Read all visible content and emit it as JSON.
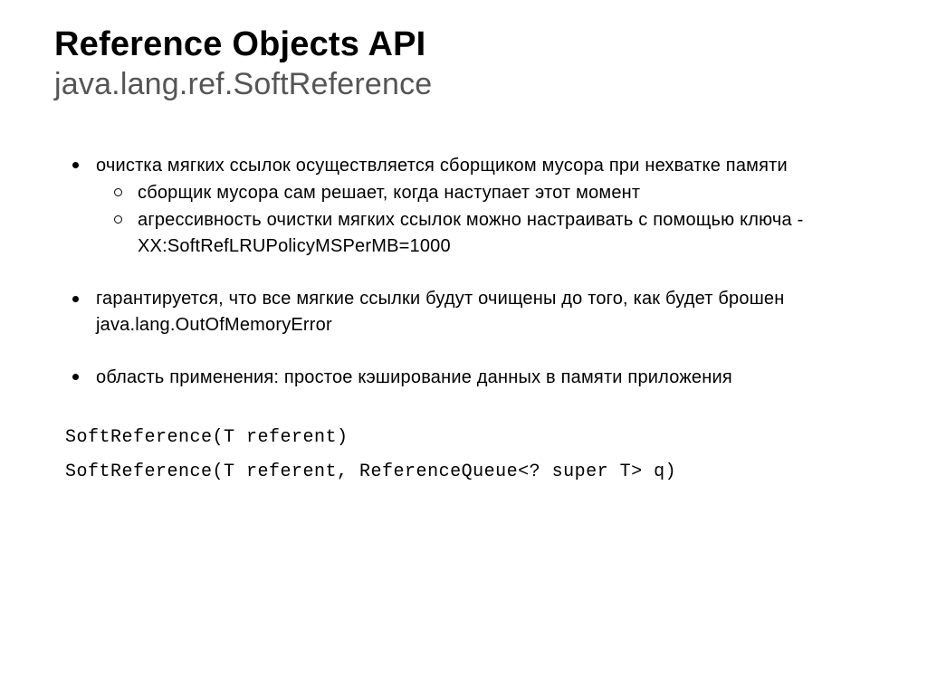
{
  "header": {
    "title": "Reference Objects API",
    "subtitle": "java.lang.ref.SoftReference"
  },
  "bullets": [
    {
      "text": "очистка мягких ссылок осуществляется сборщиком мусора при нехватке памяти",
      "children": [
        "сборщик мусора сам решает, когда наступает этот момент",
        "агрессивность очистки мягких ссылок можно настраивать с помощью ключа -XX:SoftRefLRUPolicyMSPerMB=1000"
      ]
    },
    {
      "text": "гарантируется, что все мягкие ссылки будут очищены до того, как будет брошен java.lang.OutOfMemoryError",
      "children": []
    },
    {
      "text": "область применения: простое кэширование данных в памяти приложения",
      "children": []
    }
  ],
  "code": {
    "line1": "SoftReference(T referent)",
    "line2": "SoftReference(T referent, ReferenceQueue<? super T> q)"
  }
}
